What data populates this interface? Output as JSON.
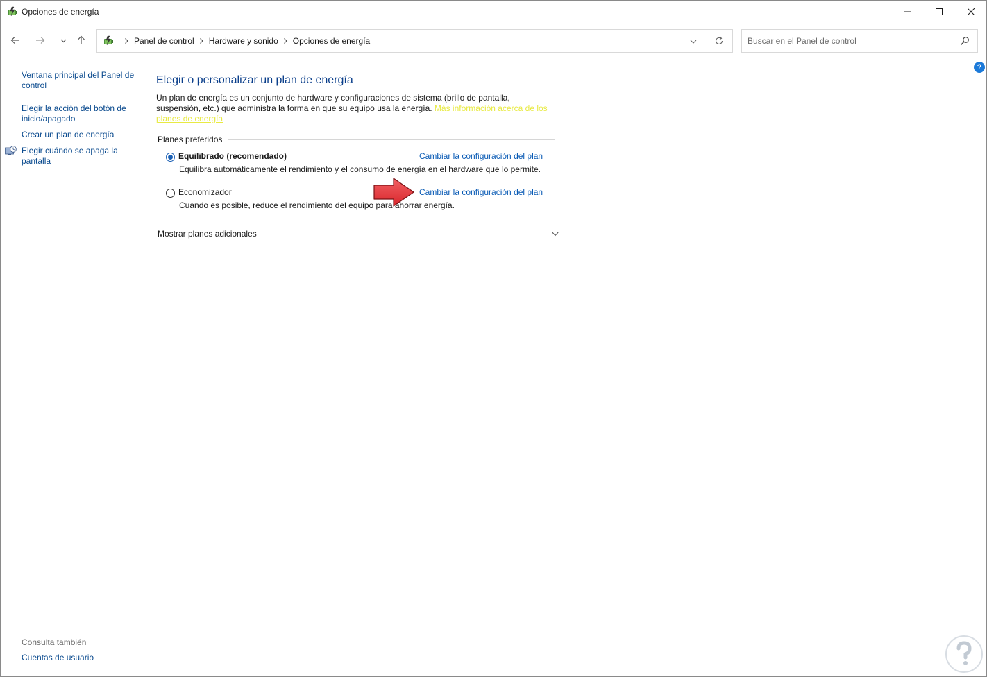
{
  "window": {
    "title": "Opciones de energía",
    "icon": "power-options-icon"
  },
  "titlebar_controls": {
    "minimize_icon": "minimize-icon",
    "maximize_icon": "maximize-icon",
    "close_icon": "close-icon"
  },
  "navigation": {
    "back_icon": "arrow-left-icon",
    "forward_icon": "arrow-right-icon",
    "recent_icon": "chevron-down-icon",
    "up_icon": "arrow-up-icon"
  },
  "address_bar": {
    "breadcrumbs": [
      "Panel de control",
      "Hardware y sonido",
      "Opciones de energía"
    ]
  },
  "search": {
    "placeholder": "Buscar en el Panel de control"
  },
  "sidebar": {
    "links": [
      "Ventana principal del Panel de control",
      "Elegir la acción del botón de inicio/apagado",
      "Crear un plan de energía",
      "Elegir cuándo se apaga la pantalla"
    ],
    "see_also_label": "Consulta también",
    "see_also_links": [
      "Cuentas de usuario"
    ]
  },
  "main": {
    "title": "Elegir o personalizar un plan de energía",
    "intro_text": "Un plan de energía es un conjunto de hardware y configuraciones de sistema (brillo de pantalla, suspensión, etc.) que administra la forma en que su equipo usa la energía. ",
    "intro_link": "Más información acerca de los planes de energía",
    "preferred_label": "Planes preferidos",
    "plans": [
      {
        "name": "Equilibrado (recomendado)",
        "selected": true,
        "description": "Equilibra automáticamente el rendimiento y el consumo de energía en el hardware que lo permite.",
        "change_link": "Cambiar la configuración del plan"
      },
      {
        "name": "Economizador",
        "selected": false,
        "description": "Cuando es posible, reduce el rendimiento del equipo para ahorrar energía.",
        "change_link": "Cambiar la configuración del plan"
      }
    ],
    "more_plans_label": "Mostrar planes adicionales"
  },
  "colors": {
    "link": "#0a5bb5",
    "title": "#0a3e8a",
    "highlight_link": "#e8ea43",
    "annotation_arrow": "#e8343a"
  }
}
